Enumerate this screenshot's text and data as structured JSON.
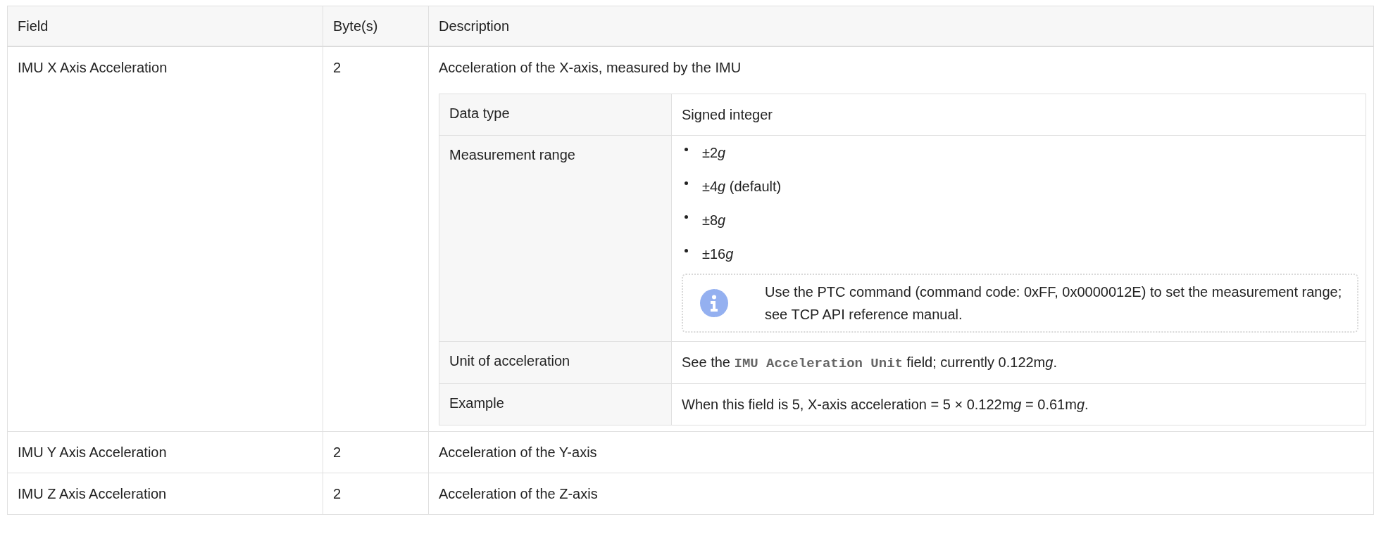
{
  "table": {
    "columns": [
      "Field",
      "Byte(s)",
      "Description"
    ],
    "rows": [
      {
        "field": "IMU X Axis Acceleration",
        "bytes": "2",
        "description": "Acceleration of the X-axis, measured by the IMU",
        "details": [
          {
            "kind": "text",
            "label": "Data type",
            "segments": [
              {
                "kind": "text",
                "text": "Signed integer"
              }
            ]
          },
          {
            "kind": "list",
            "label": "Measurement range",
            "items": [
              [
                {
                  "kind": "text",
                  "text": "±2"
                },
                {
                  "kind": "italic",
                  "text": "g"
                }
              ],
              [
                {
                  "kind": "text",
                  "text": "±4"
                },
                {
                  "kind": "italic",
                  "text": "g"
                },
                {
                  "kind": "text",
                  "text": " (default)"
                }
              ],
              [
                {
                  "kind": "text",
                  "text": "±8"
                },
                {
                  "kind": "italic",
                  "text": "g"
                }
              ],
              [
                {
                  "kind": "text",
                  "text": "±16"
                },
                {
                  "kind": "italic",
                  "text": "g"
                }
              ]
            ],
            "note": "Use the PTC command (command code: 0xFF, 0x0000012E) to set the measurement range; see TCP API reference manual."
          },
          {
            "kind": "text",
            "label": "Unit of acceleration",
            "segments": [
              {
                "kind": "text",
                "text": "See the "
              },
              {
                "kind": "code",
                "text": "IMU Acceleration Unit"
              },
              {
                "kind": "text",
                "text": " field; currently 0.122m"
              },
              {
                "kind": "italic",
                "text": "g"
              },
              {
                "kind": "text",
                "text": "."
              }
            ]
          },
          {
            "kind": "text",
            "label": "Example",
            "segments": [
              {
                "kind": "text",
                "text": "When this field is 5, X-axis acceleration = 5 × 0.122m"
              },
              {
                "kind": "italic",
                "text": "g"
              },
              {
                "kind": "text",
                "text": " = 0.61m"
              },
              {
                "kind": "italic",
                "text": "g"
              },
              {
                "kind": "text",
                "text": "."
              }
            ]
          }
        ]
      },
      {
        "field": "IMU Y Axis Acceleration",
        "bytes": "2",
        "description": "Acceleration of the Y-axis"
      },
      {
        "field": "IMU Z Axis Acceleration",
        "bytes": "2",
        "description": "Acceleration of the Z-axis"
      }
    ]
  }
}
